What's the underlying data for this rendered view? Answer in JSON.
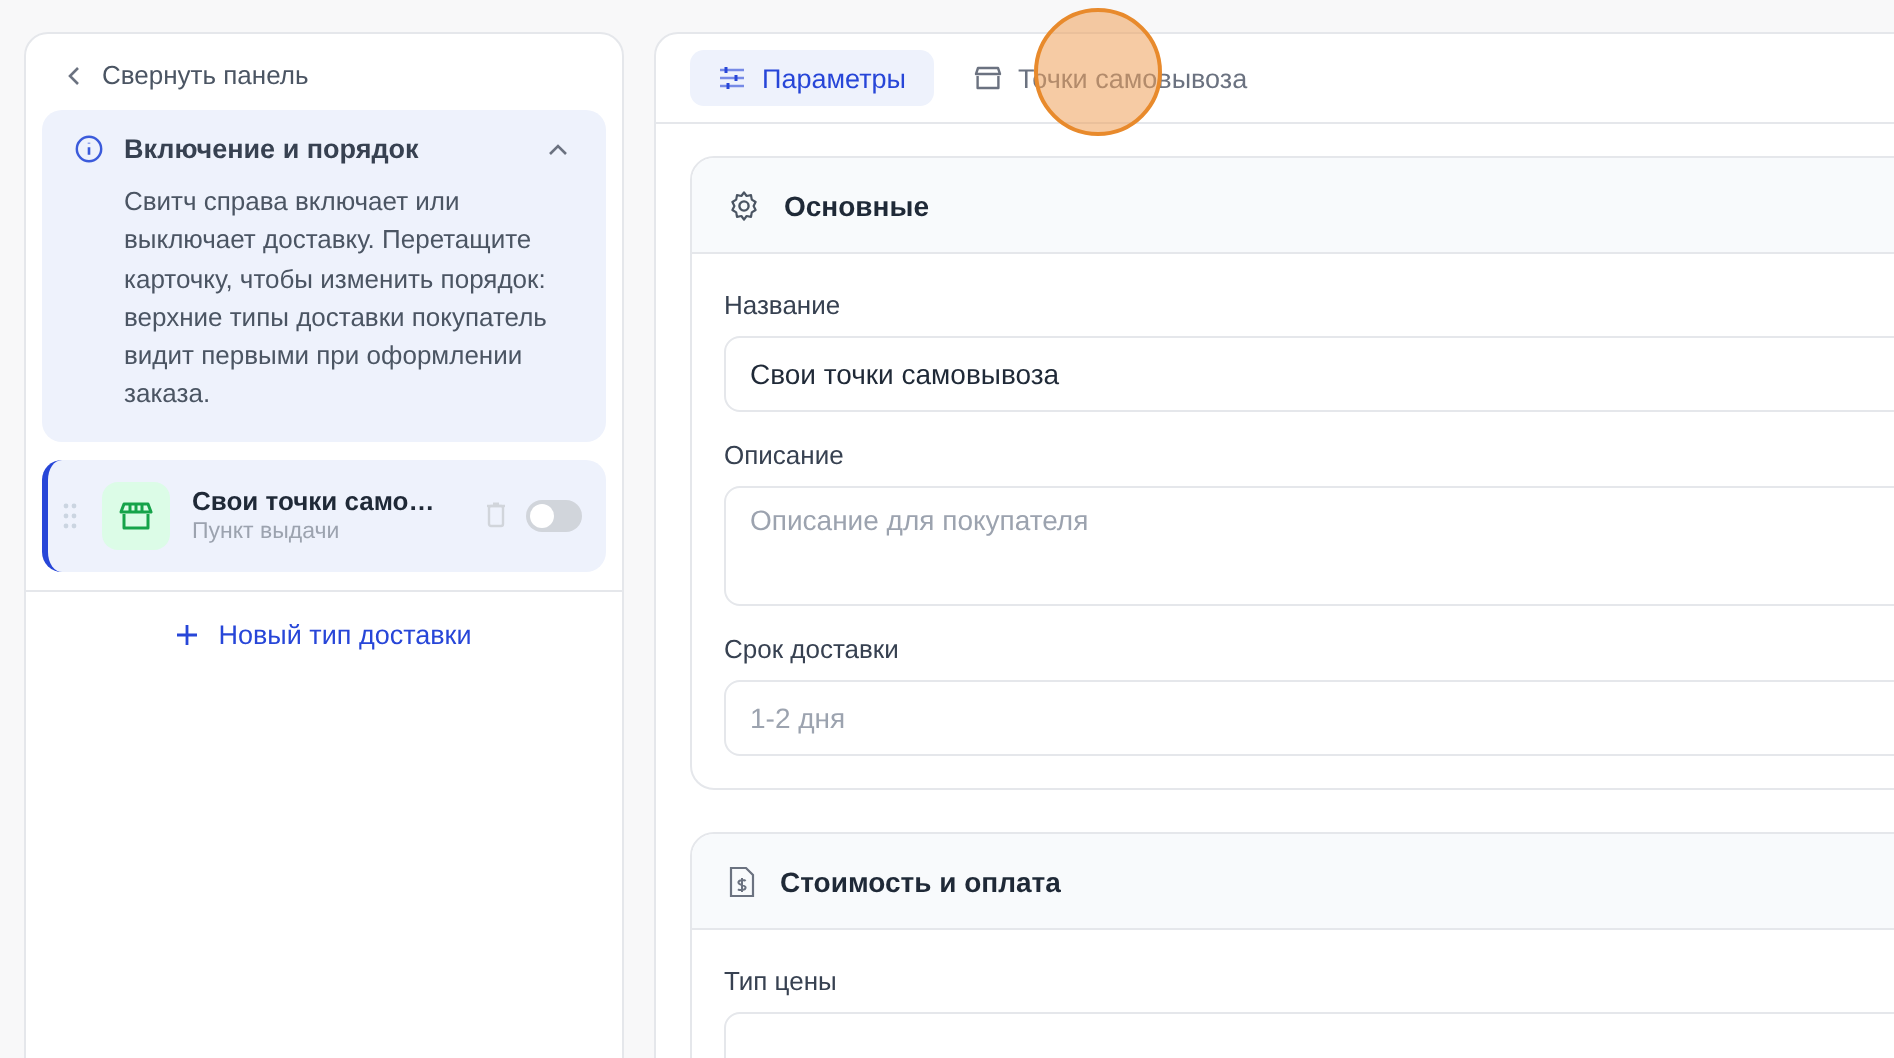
{
  "sidebar": {
    "collapse_label": "Свернуть панель",
    "info": {
      "title": "Включение и порядок",
      "expanded": true,
      "text": "Свитч справа включает или выключает доставку. Перетащите карточку, чтобы изменить порядок: верхние типы доставки покупатель видит первыми при оформлении заказа."
    },
    "delivery_types": [
      {
        "title": "Свои точки само…",
        "subtitle": "Пункт выдачи",
        "selected": true,
        "on": false
      }
    ],
    "add_label": "Новый тип доставки"
  },
  "tabs": [
    {
      "label": "Параметры",
      "kind": "settings",
      "selected": true
    },
    {
      "label": "Точки самовывоза",
      "kind": "store",
      "selected": false
    }
  ],
  "sections": [
    {
      "title": "Основные",
      "kind": "gear",
      "fields": [
        {
          "label": "Название",
          "value": "Свои точки самовывоза",
          "kind": "input"
        },
        {
          "label": "Описание",
          "placeholder": "Описание для покупателя",
          "kind": "textarea"
        },
        {
          "label": "Срок доставки",
          "placeholder": "1-2 дня",
          "kind": "input"
        }
      ]
    },
    {
      "title": "Стоимость и оплата",
      "kind": "invoice",
      "fields": [
        {
          "label": "Тип цены",
          "kind": "input"
        }
      ]
    }
  ]
}
